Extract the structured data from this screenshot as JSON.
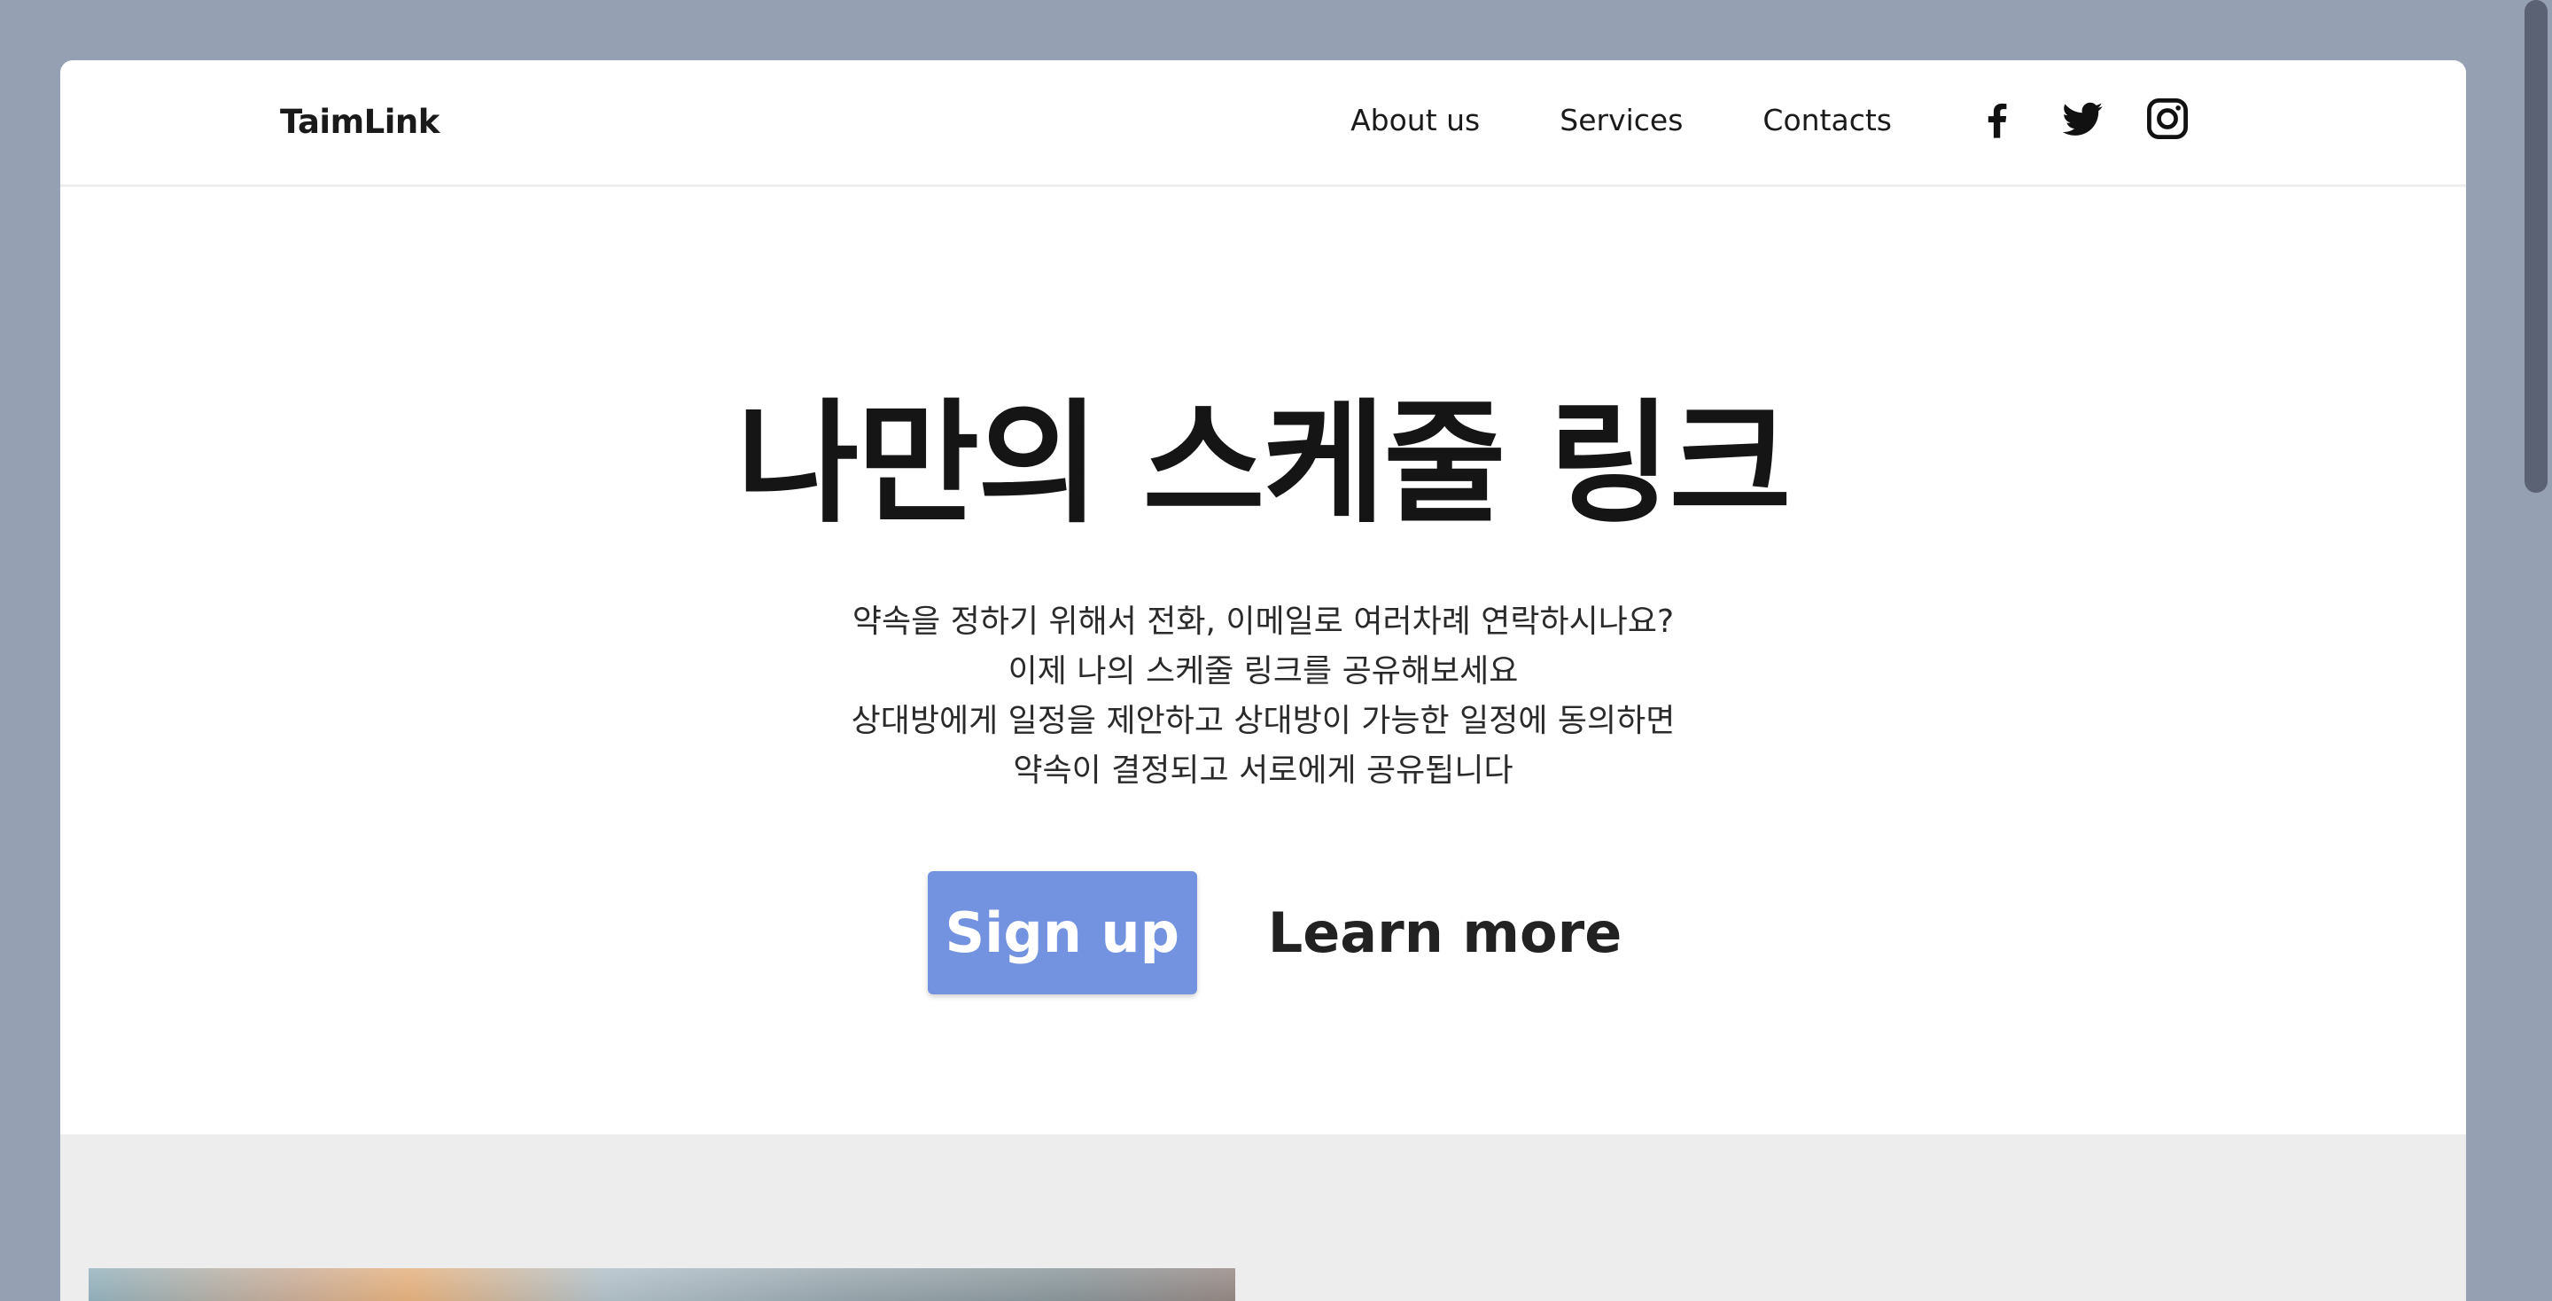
{
  "nav": {
    "logo": "TaimLink",
    "links": [
      {
        "label": "About us"
      },
      {
        "label": "Services"
      },
      {
        "label": "Contacts"
      }
    ],
    "socials": [
      "facebook-icon",
      "twitter-icon",
      "instagram-icon"
    ]
  },
  "hero": {
    "title": "나만의 스케줄 링크",
    "description": [
      "약속을 정하기 위해서 전화, 이메일로 여러차례 연락하시나요?",
      "이제 나의 스케줄 링크를 공유해보세요",
      "상대방에게 일정을 제안하고 상대방이 가능한 일정에 동의하면",
      "약속이 결정되고 서로에게 공유됩니다"
    ],
    "signup_label": "Sign up",
    "learn_more_label": "Learn more"
  },
  "colors": {
    "background": "#95a0b2",
    "primary_button": "#7393e1",
    "text": "#151515",
    "section_gray": "#ededed"
  }
}
